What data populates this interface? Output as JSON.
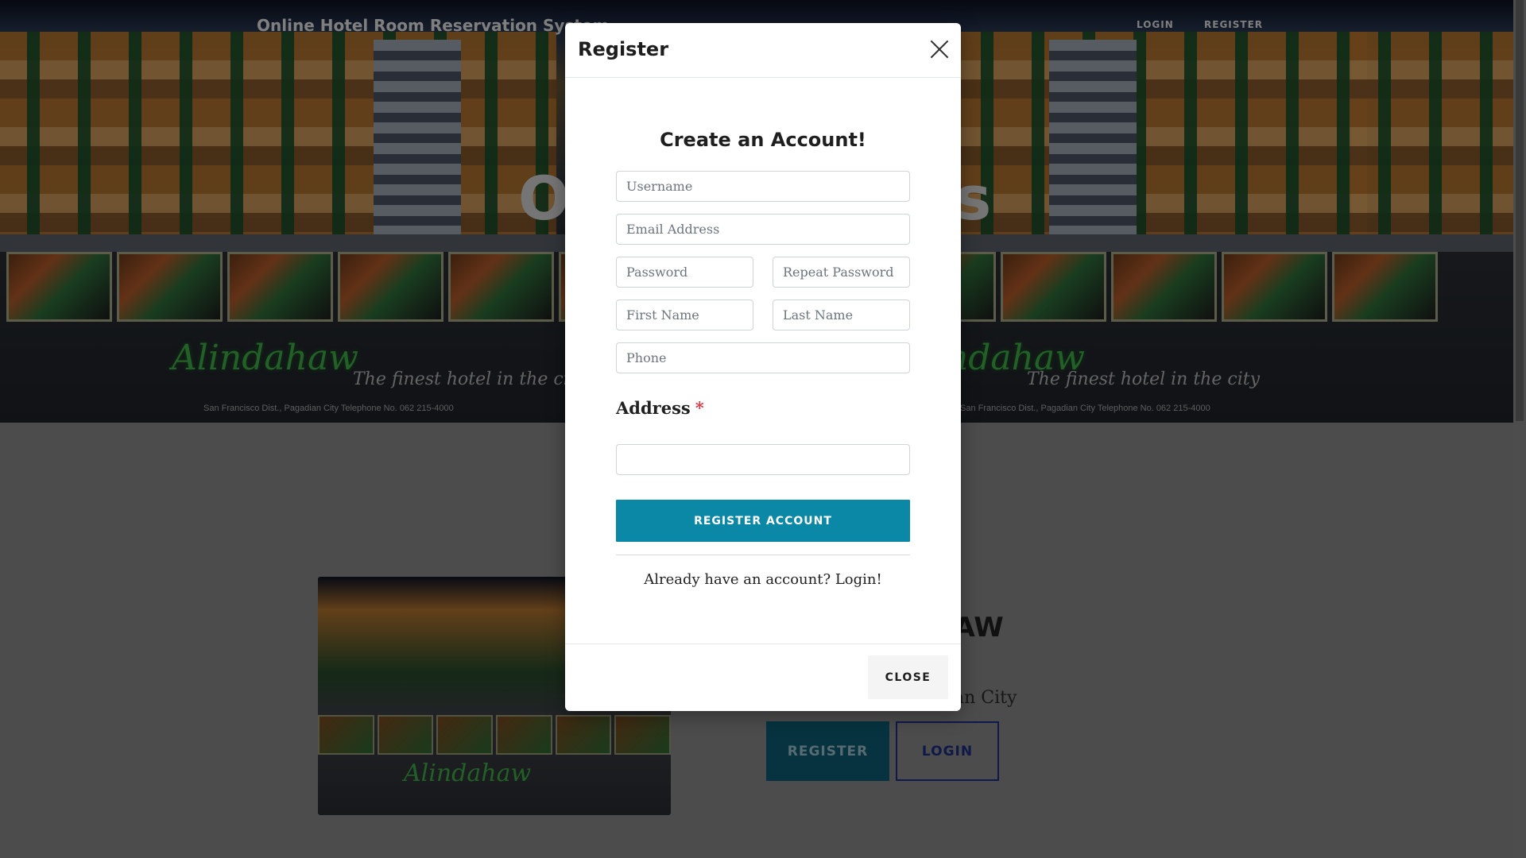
{
  "navbar": {
    "brand": "Online Hotel Room Reservation System",
    "login_label": "LOGIN",
    "register_label": "REGISTER"
  },
  "hero": {
    "title_left": "O",
    "title_right": "s",
    "logo_text": "Alindahaw",
    "tagline": "The finest hotel in the city",
    "address_line": "San Francisco Dist., Pagadian City     Telephone No. 062 215-4000"
  },
  "content": {
    "hotel_title": "HAW",
    "hotel_city": "an City",
    "register_button": "REGISTER",
    "login_button": "LOGIN"
  },
  "modal": {
    "title": "Register",
    "heading": "Create an Account!",
    "fields": {
      "username_placeholder": "Username",
      "email_placeholder": "Email Address",
      "password_placeholder": "Password",
      "repeat_password_placeholder": "Repeat Password",
      "first_name_placeholder": "First Name",
      "last_name_placeholder": "Last Name",
      "phone_placeholder": "Phone",
      "address_label": "Address",
      "address_required_mark": "*",
      "address_value": ""
    },
    "register_account_label": "REGISTER ACCOUNT",
    "login_prompt": "Already have an account? Login!",
    "close_label": "CLOSE"
  },
  "colors": {
    "primary_button": "#0b88a5",
    "required_mark": "#dc3545"
  }
}
